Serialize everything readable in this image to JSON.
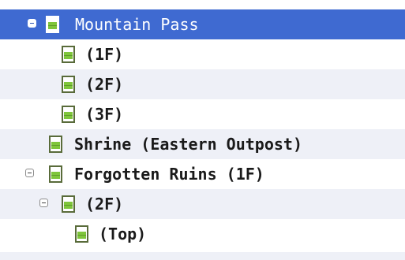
{
  "tree": {
    "items": [
      {
        "label": "Mountain Pass",
        "icon": "document-icon",
        "expanded": true,
        "selected": true
      },
      {
        "label": "(1F)",
        "icon": "document-icon"
      },
      {
        "label": "(2F)",
        "icon": "document-icon"
      },
      {
        "label": "(3F)",
        "icon": "document-icon"
      },
      {
        "label": "Shrine (Eastern Outpost)",
        "icon": "document-icon"
      },
      {
        "label": "Forgotten Ruins (1F)",
        "icon": "document-icon",
        "expanded": true
      },
      {
        "label": "(2F)",
        "icon": "document-icon",
        "expanded": true
      },
      {
        "label": "(Top)",
        "icon": "document-icon"
      }
    ]
  },
  "colors": {
    "selection": "#3f6ad1",
    "alt_row": "#eef0f7",
    "icon_fill": "#7fc63b"
  }
}
